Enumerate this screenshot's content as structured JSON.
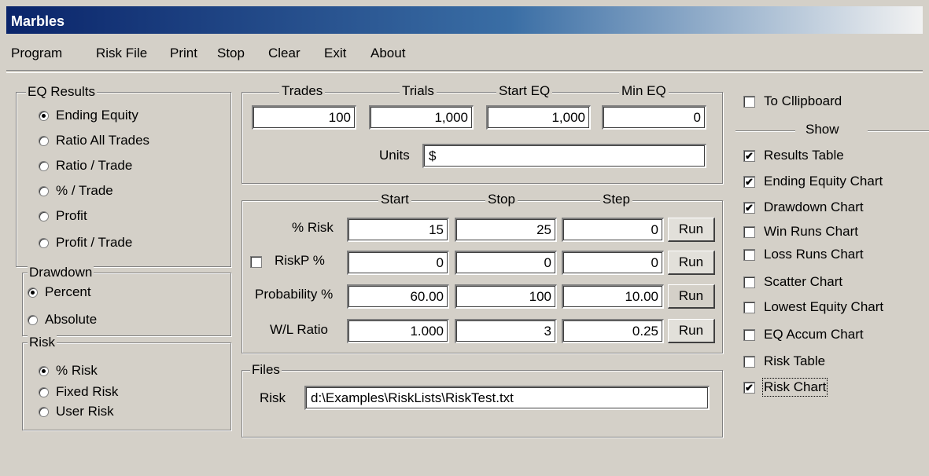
{
  "window": {
    "title": "Marbles"
  },
  "menu": [
    "Program",
    "Risk File",
    "Print",
    "Stop",
    "Clear",
    "Exit",
    "About"
  ],
  "eq_results": {
    "legend": "EQ Results",
    "options": [
      "Ending Equity",
      "Ratio All Trades",
      "Ratio / Trade",
      "% / Trade",
      "Profit",
      "Profit / Trade"
    ],
    "selected": "Ending Equity"
  },
  "drawdown": {
    "legend": "Drawdown",
    "options": [
      "Percent",
      "Absolute"
    ],
    "selected": "Percent"
  },
  "risk_group": {
    "legend": "Risk",
    "options": [
      "% Risk",
      "Fixed Risk",
      "User Risk"
    ],
    "selected": "% Risk"
  },
  "params": {
    "headers": [
      "Trades",
      "Trials",
      "Start EQ",
      "Min EQ"
    ],
    "values": [
      "100",
      "1,000",
      "1,000",
      "0"
    ],
    "units_label": "Units",
    "units_value": "$"
  },
  "sweep": {
    "headers": [
      "Start",
      "Stop",
      "Step"
    ],
    "run_label": "Run",
    "rows": [
      {
        "label": "% Risk",
        "start": "15",
        "stop": "25",
        "step": "0",
        "has_checkbox": false
      },
      {
        "label": "RiskP %",
        "start": "0",
        "stop": "0",
        "step": "0",
        "has_checkbox": true,
        "checked": false
      },
      {
        "label": "Probability %",
        "start": "60.00",
        "stop": "100",
        "step": "10.00",
        "has_checkbox": false
      },
      {
        "label": "W/L Ratio",
        "start": "1.000",
        "stop": "3",
        "step": "0.25",
        "has_checkbox": false
      }
    ]
  },
  "files": {
    "legend": "Files",
    "risk_label": "Risk",
    "risk_path": "d:\\Examples\\RiskLists\\RiskTest.txt"
  },
  "clipboard": {
    "label": "To Cllipboard",
    "checked": false
  },
  "show": {
    "header": "Show",
    "items": [
      {
        "label": "Results Table",
        "checked": true
      },
      {
        "label": "Ending Equity Chart",
        "checked": true
      },
      {
        "label": "Drawdown Chart",
        "checked": true
      },
      {
        "label": "Win Runs Chart",
        "checked": false
      },
      {
        "label": "Loss Runs Chart",
        "checked": false
      },
      {
        "label": "Scatter Chart",
        "checked": false
      },
      {
        "label": "Lowest Equity Chart",
        "checked": false
      },
      {
        "label": "EQ Accum Chart",
        "checked": false
      },
      {
        "label": "Risk Table",
        "checked": false
      },
      {
        "label": "Risk Chart",
        "checked": true
      }
    ]
  }
}
